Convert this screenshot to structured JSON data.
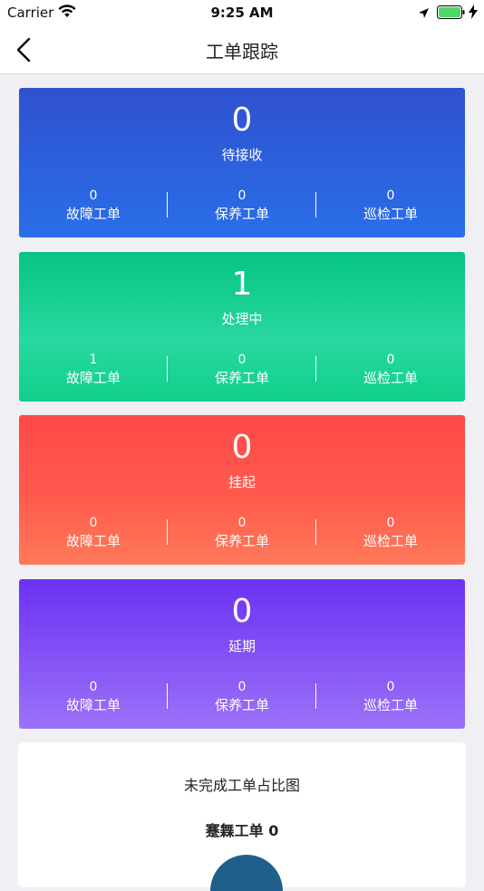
{
  "status_bar": {
    "carrier": "Carrier",
    "time": "9:25 AM"
  },
  "nav": {
    "title": "工单跟踪",
    "back_icon": "chevron-left-icon"
  },
  "cards": [
    {
      "count": "0",
      "label": "待接收",
      "color_top": "#2f51cf",
      "color_bottom": "#2a6ee9",
      "breakdown": [
        {
          "value": "0",
          "label": "故障工单"
        },
        {
          "value": "0",
          "label": "保养工单"
        },
        {
          "value": "0",
          "label": "巡检工单"
        }
      ]
    },
    {
      "count": "1",
      "label": "处理中",
      "color_top": "#06c482",
      "color_bottom": "#10cf8a",
      "breakdown": [
        {
          "value": "1",
          "label": "故障工单"
        },
        {
          "value": "0",
          "label": "保养工单"
        },
        {
          "value": "0",
          "label": "巡检工单"
        }
      ]
    },
    {
      "count": "0",
      "label": "挂起",
      "color_top": "#ff4848",
      "color_bottom": "#ff7a5a",
      "breakdown": [
        {
          "value": "0",
          "label": "故障工单"
        },
        {
          "value": "0",
          "label": "保养工单"
        },
        {
          "value": "0",
          "label": "巡检工单"
        }
      ]
    },
    {
      "count": "0",
      "label": "延期",
      "color_top": "#6c31f3",
      "color_bottom": "#9b73f8",
      "breakdown": [
        {
          "value": "0",
          "label": "故障工单"
        },
        {
          "value": "0",
          "label": "保养工单"
        },
        {
          "value": "0",
          "label": "巡检工单"
        }
      ]
    }
  ],
  "chart_panel": {
    "title": "未完成工单占比图",
    "stat": "蹇橆工单 0",
    "pie_color": "#1e5f8c"
  }
}
